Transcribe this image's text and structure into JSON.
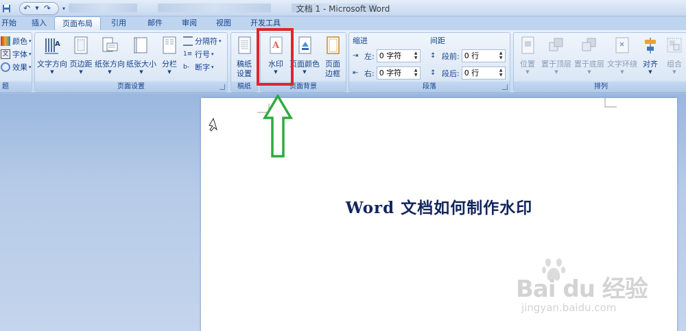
{
  "window": {
    "title": "文档 1 - Microsoft Word"
  },
  "tabs": [
    {
      "label": "开始"
    },
    {
      "label": "插入"
    },
    {
      "label": "页面布局",
      "active": true
    },
    {
      "label": "引用"
    },
    {
      "label": "邮件"
    },
    {
      "label": "审阅"
    },
    {
      "label": "视图"
    },
    {
      "label": "开发工具"
    }
  ],
  "ribbon": {
    "theme": {
      "label": "题",
      "items": [
        "颜色",
        "字体",
        "效果"
      ]
    },
    "page_setup": {
      "label": "页面设置",
      "buttons": [
        "文字方向",
        "页边距",
        "纸张方向",
        "纸张大小",
        "分栏"
      ],
      "small": [
        "分隔符",
        "行号",
        "断字"
      ]
    },
    "manuscript": {
      "label": "稿纸",
      "button_line1": "稿纸",
      "button_line2": "设置"
    },
    "page_background": {
      "label": "页面背景",
      "watermark": "水印",
      "page_color": "页面颜色",
      "border_line1": "页面",
      "border_line2": "边框"
    },
    "paragraph": {
      "label": "段落",
      "indent_title": "缩进",
      "spacing_title": "间距",
      "indent_left_label": "左:",
      "indent_left_value": "0 字符",
      "indent_right_label": "右:",
      "indent_right_value": "0 字符",
      "space_before_label": "段前:",
      "space_before_value": "0 行",
      "space_after_label": "段后:",
      "space_after_value": "0 行"
    },
    "arrange": {
      "label": "排列",
      "buttons": [
        "位置",
        "置于顶层",
        "置于底层",
        "文字环绕",
        "对齐",
        "组合"
      ]
    }
  },
  "document": {
    "heading": "Word 文档如何制作水印"
  },
  "watermark_overlay": {
    "brand": "Bai du 经验",
    "url": "jingyan.baidu.com"
  },
  "colors": {
    "highlight": "#e0242b",
    "arrow": "#2eaa3e",
    "ribbon_text": "#15428b",
    "doc_title": "#12255c"
  }
}
